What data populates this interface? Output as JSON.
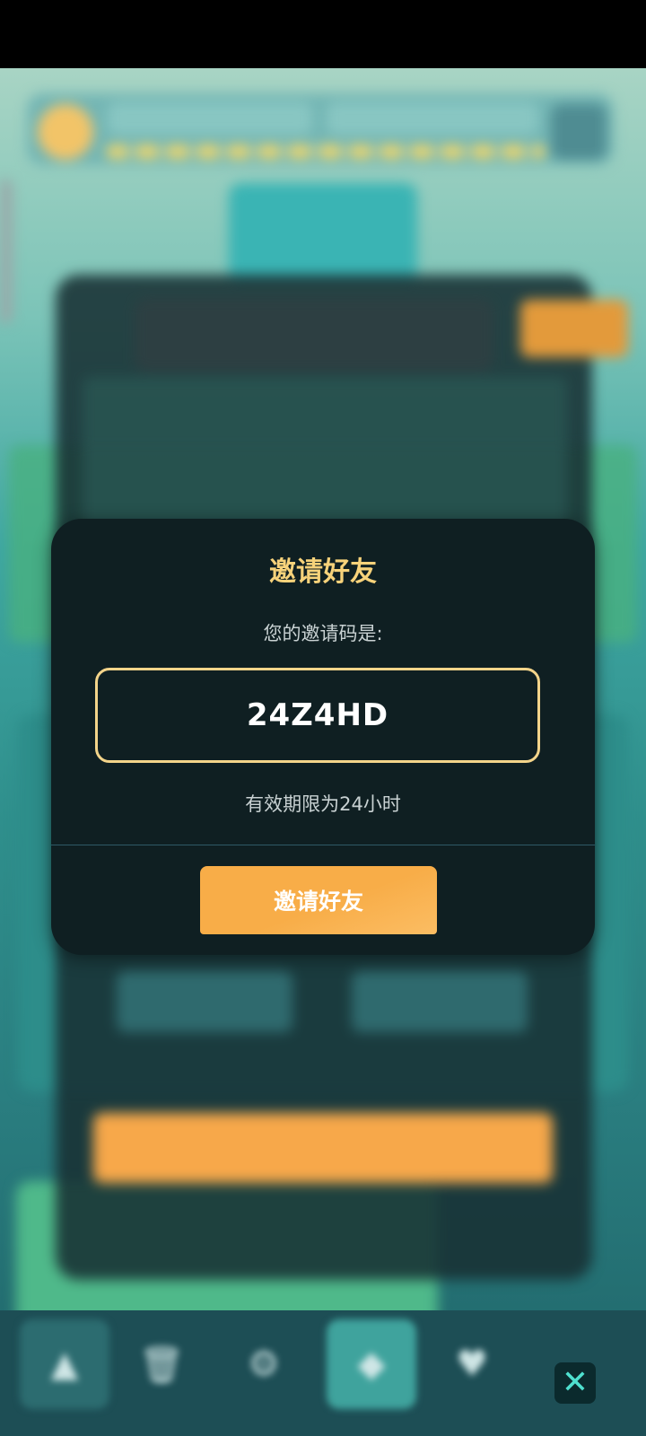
{
  "modal": {
    "title": "邀请好友",
    "subtitle": "您的邀请码是:",
    "invite_code": "24Z4HD",
    "expiry_text": "有效期限为24小时",
    "invite_button_label": "邀请好友"
  },
  "close_button": {
    "icon": "close-icon",
    "glyph": "✕"
  },
  "bottom_nav": {
    "items": [
      {
        "icon": "triangle-icon",
        "glyph": "▲"
      },
      {
        "icon": "trash-icon",
        "glyph": "🗑"
      },
      {
        "icon": "gear-icon",
        "glyph": "⚙"
      },
      {
        "icon": "gem-icon",
        "glyph": "◆"
      },
      {
        "icon": "heart-icon",
        "glyph": "♥"
      }
    ]
  },
  "colors": {
    "accent_gold": "#f7d27a",
    "button_orange": "#f8ad48",
    "modal_bg": "#0f1f22",
    "close_icon": "#4fe0cf"
  }
}
